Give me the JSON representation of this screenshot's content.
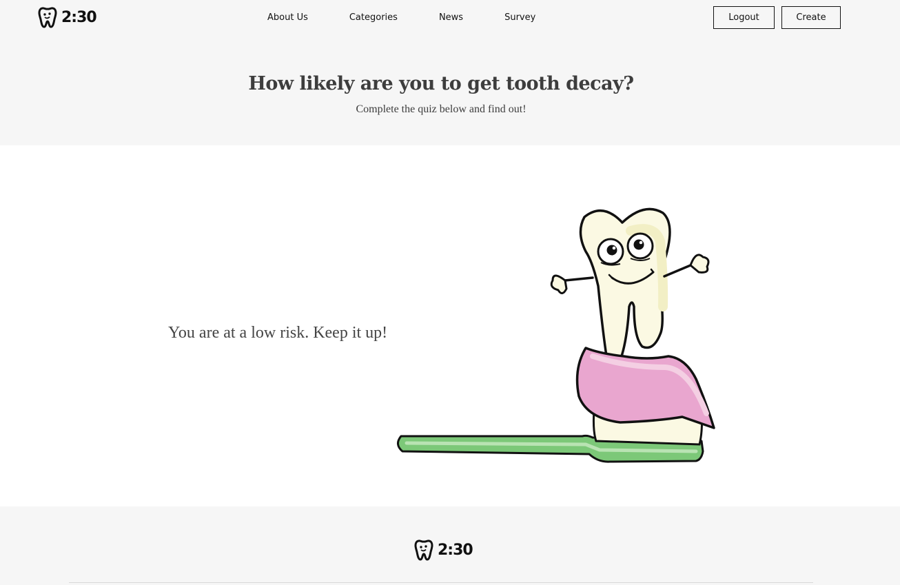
{
  "header": {
    "logo_text": "2:30",
    "logo_icon": "tooth-icon",
    "nav": [
      {
        "label": "About Us"
      },
      {
        "label": "Categories"
      },
      {
        "label": "News"
      },
      {
        "label": "Survey"
      }
    ],
    "logout_label": "Logout",
    "create_label": "Create"
  },
  "hero": {
    "title": "How likely are you to get tooth decay?",
    "subtitle": "Complete the quiz below and find out!"
  },
  "result": {
    "text": "You are at a low risk. Keep it up!",
    "illustration": "happy-tooth-on-toothbrush-illustration"
  },
  "footer": {
    "logo_text": "2:30",
    "logo_icon": "tooth-icon"
  },
  "colors": {
    "header_bg": "#f6f6f6",
    "text_dark": "#3d3d3d",
    "toothbrush_green": "#6fc06a",
    "toothpaste_pink": "#e9a6cf",
    "tooth_cream": "#fbf9e3"
  }
}
